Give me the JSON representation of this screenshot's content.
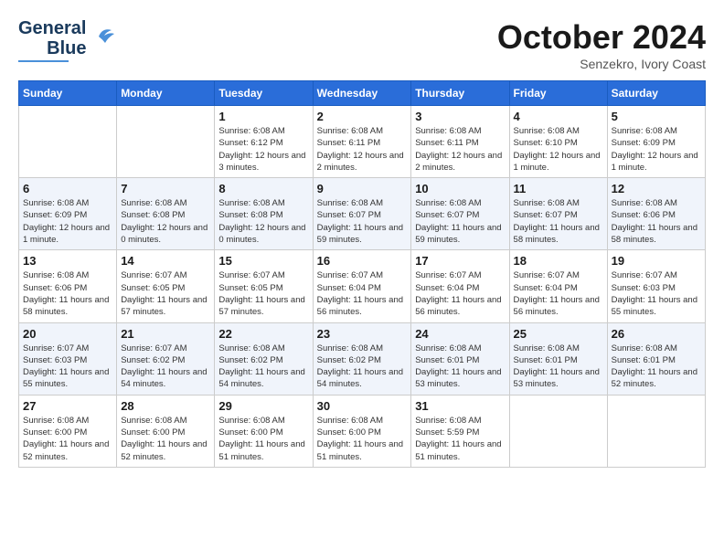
{
  "header": {
    "logo_line1": "General",
    "logo_line2": "Blue",
    "month": "October 2024",
    "location": "Senzekro, Ivory Coast"
  },
  "weekdays": [
    "Sunday",
    "Monday",
    "Tuesday",
    "Wednesday",
    "Thursday",
    "Friday",
    "Saturday"
  ],
  "weeks": [
    [
      {
        "day": "",
        "info": ""
      },
      {
        "day": "",
        "info": ""
      },
      {
        "day": "1",
        "info": "Sunrise: 6:08 AM\nSunset: 6:12 PM\nDaylight: 12 hours and 3 minutes."
      },
      {
        "day": "2",
        "info": "Sunrise: 6:08 AM\nSunset: 6:11 PM\nDaylight: 12 hours and 2 minutes."
      },
      {
        "day": "3",
        "info": "Sunrise: 6:08 AM\nSunset: 6:11 PM\nDaylight: 12 hours and 2 minutes."
      },
      {
        "day": "4",
        "info": "Sunrise: 6:08 AM\nSunset: 6:10 PM\nDaylight: 12 hours and 1 minute."
      },
      {
        "day": "5",
        "info": "Sunrise: 6:08 AM\nSunset: 6:09 PM\nDaylight: 12 hours and 1 minute."
      }
    ],
    [
      {
        "day": "6",
        "info": "Sunrise: 6:08 AM\nSunset: 6:09 PM\nDaylight: 12 hours and 1 minute."
      },
      {
        "day": "7",
        "info": "Sunrise: 6:08 AM\nSunset: 6:08 PM\nDaylight: 12 hours and 0 minutes."
      },
      {
        "day": "8",
        "info": "Sunrise: 6:08 AM\nSunset: 6:08 PM\nDaylight: 12 hours and 0 minutes."
      },
      {
        "day": "9",
        "info": "Sunrise: 6:08 AM\nSunset: 6:07 PM\nDaylight: 11 hours and 59 minutes."
      },
      {
        "day": "10",
        "info": "Sunrise: 6:08 AM\nSunset: 6:07 PM\nDaylight: 11 hours and 59 minutes."
      },
      {
        "day": "11",
        "info": "Sunrise: 6:08 AM\nSunset: 6:07 PM\nDaylight: 11 hours and 58 minutes."
      },
      {
        "day": "12",
        "info": "Sunrise: 6:08 AM\nSunset: 6:06 PM\nDaylight: 11 hours and 58 minutes."
      }
    ],
    [
      {
        "day": "13",
        "info": "Sunrise: 6:08 AM\nSunset: 6:06 PM\nDaylight: 11 hours and 58 minutes."
      },
      {
        "day": "14",
        "info": "Sunrise: 6:07 AM\nSunset: 6:05 PM\nDaylight: 11 hours and 57 minutes."
      },
      {
        "day": "15",
        "info": "Sunrise: 6:07 AM\nSunset: 6:05 PM\nDaylight: 11 hours and 57 minutes."
      },
      {
        "day": "16",
        "info": "Sunrise: 6:07 AM\nSunset: 6:04 PM\nDaylight: 11 hours and 56 minutes."
      },
      {
        "day": "17",
        "info": "Sunrise: 6:07 AM\nSunset: 6:04 PM\nDaylight: 11 hours and 56 minutes."
      },
      {
        "day": "18",
        "info": "Sunrise: 6:07 AM\nSunset: 6:04 PM\nDaylight: 11 hours and 56 minutes."
      },
      {
        "day": "19",
        "info": "Sunrise: 6:07 AM\nSunset: 6:03 PM\nDaylight: 11 hours and 55 minutes."
      }
    ],
    [
      {
        "day": "20",
        "info": "Sunrise: 6:07 AM\nSunset: 6:03 PM\nDaylight: 11 hours and 55 minutes."
      },
      {
        "day": "21",
        "info": "Sunrise: 6:07 AM\nSunset: 6:02 PM\nDaylight: 11 hours and 54 minutes."
      },
      {
        "day": "22",
        "info": "Sunrise: 6:08 AM\nSunset: 6:02 PM\nDaylight: 11 hours and 54 minutes."
      },
      {
        "day": "23",
        "info": "Sunrise: 6:08 AM\nSunset: 6:02 PM\nDaylight: 11 hours and 54 minutes."
      },
      {
        "day": "24",
        "info": "Sunrise: 6:08 AM\nSunset: 6:01 PM\nDaylight: 11 hours and 53 minutes."
      },
      {
        "day": "25",
        "info": "Sunrise: 6:08 AM\nSunset: 6:01 PM\nDaylight: 11 hours and 53 minutes."
      },
      {
        "day": "26",
        "info": "Sunrise: 6:08 AM\nSunset: 6:01 PM\nDaylight: 11 hours and 52 minutes."
      }
    ],
    [
      {
        "day": "27",
        "info": "Sunrise: 6:08 AM\nSunset: 6:00 PM\nDaylight: 11 hours and 52 minutes."
      },
      {
        "day": "28",
        "info": "Sunrise: 6:08 AM\nSunset: 6:00 PM\nDaylight: 11 hours and 52 minutes."
      },
      {
        "day": "29",
        "info": "Sunrise: 6:08 AM\nSunset: 6:00 PM\nDaylight: 11 hours and 51 minutes."
      },
      {
        "day": "30",
        "info": "Sunrise: 6:08 AM\nSunset: 6:00 PM\nDaylight: 11 hours and 51 minutes."
      },
      {
        "day": "31",
        "info": "Sunrise: 6:08 AM\nSunset: 5:59 PM\nDaylight: 11 hours and 51 minutes."
      },
      {
        "day": "",
        "info": ""
      },
      {
        "day": "",
        "info": ""
      }
    ]
  ]
}
